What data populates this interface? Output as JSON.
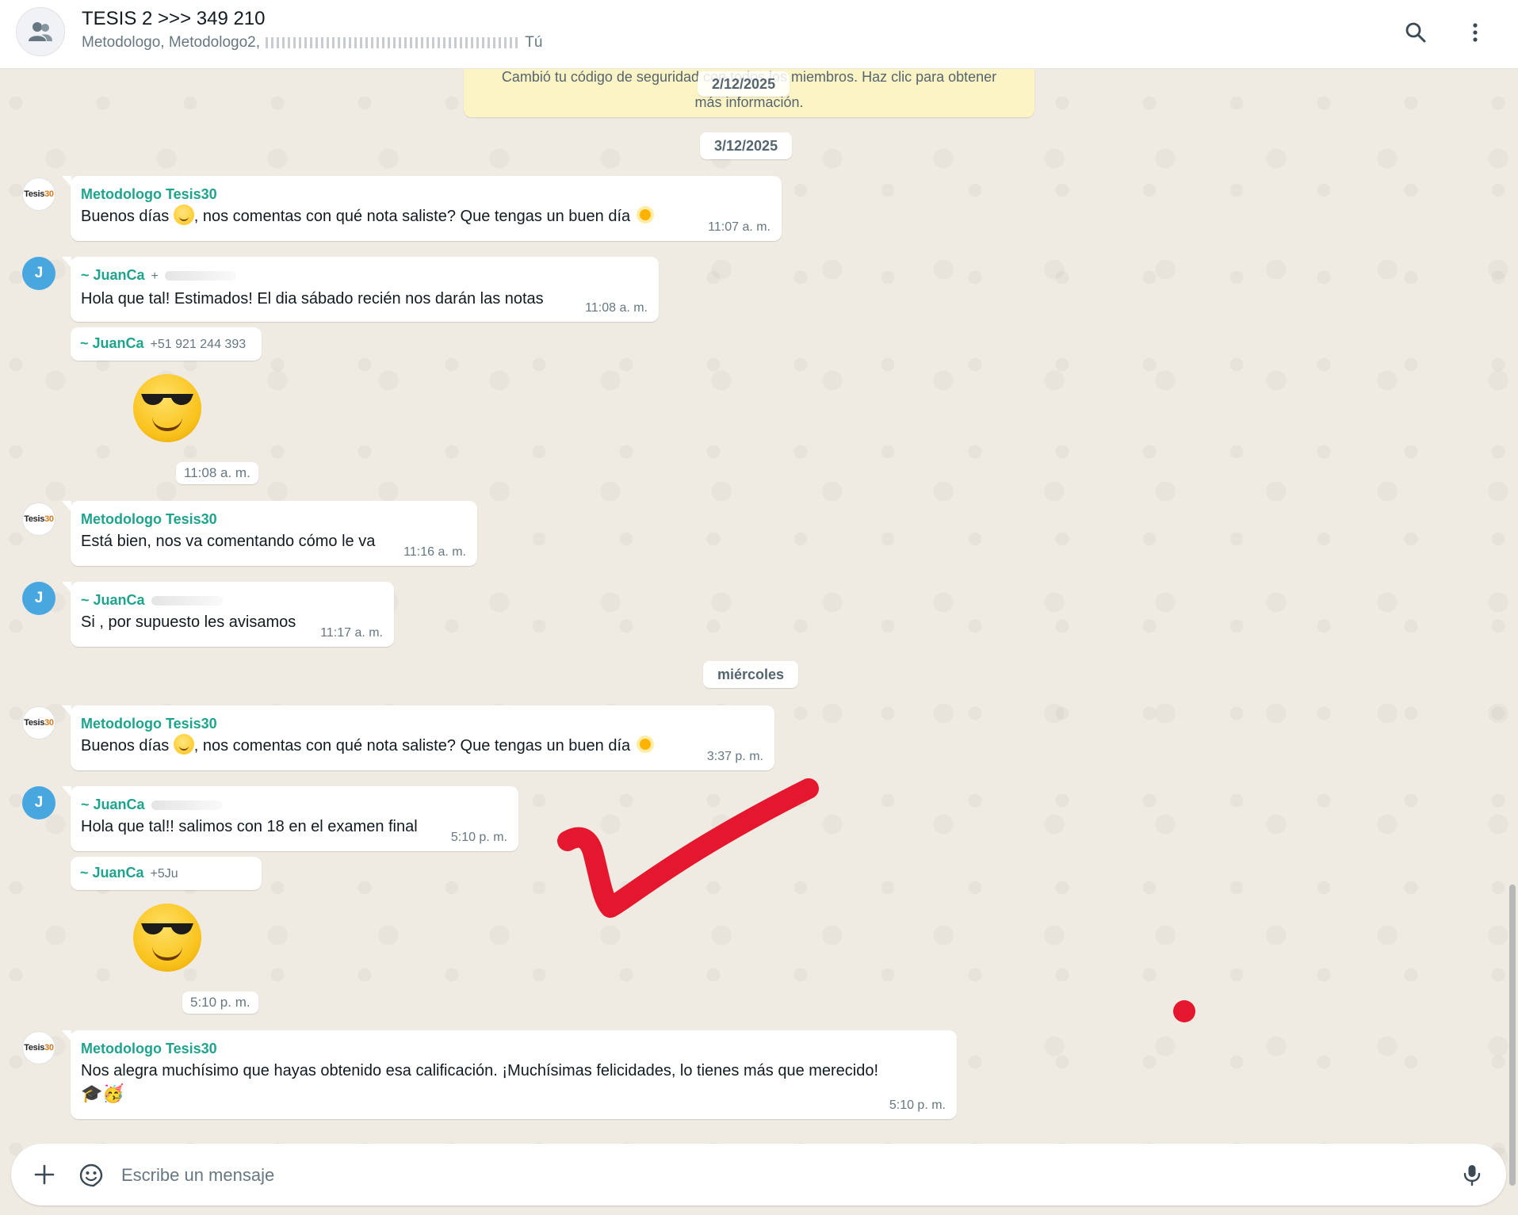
{
  "header": {
    "title": "TESIS 2 >>> 349 210",
    "subtitle_prefix": "Metodologo, Metodologo2,",
    "subtitle_suffix": "Tú"
  },
  "notice": {
    "line1": "Cambió tu código de seguridad con todos los miembros. Haz clic para obtener",
    "line2": "más información."
  },
  "dates": {
    "first": "2/12/2025",
    "second": "3/12/2025",
    "third": "miércoles"
  },
  "avatars": {
    "tesis_label_a": "Tesis",
    "tesis_label_b": "30",
    "juanca_initial": "J"
  },
  "messages": [
    {
      "sender": "Metodologo Tesis30",
      "text_a": "Buenos días ",
      "text_b": ", nos comentas con qué nota saliste? Que tengas un buen día ",
      "time": "11:07 a. m."
    },
    {
      "sender": "~ JuanCa",
      "phone": "+",
      "text": "Hola que tal! Estimados! El dia sábado recién nos darán las notas",
      "time": "11:08 a. m."
    },
    {
      "sender": "~ JuanCa",
      "phone": "+51 921 244 393",
      "time": "11:08 a. m."
    },
    {
      "sender": "Metodologo Tesis30",
      "text": "Está bien, nos va comentando cómo le va",
      "time": "11:16 a. m."
    },
    {
      "sender": "~ JuanCa",
      "text": "Si , por supuesto les avisamos",
      "time": "11:17 a. m."
    },
    {
      "sender": "Metodologo Tesis30",
      "text_a": "Buenos días ",
      "text_b": ", nos comentas con qué nota saliste? Que tengas un buen día ",
      "time": "3:37 p. m."
    },
    {
      "sender": "~ JuanCa",
      "text": "Hola que tal!! salimos con 18 en el examen final",
      "time": "5:10 p. m."
    },
    {
      "sender": "~ JuanCa",
      "phone": "+5Ju",
      "time": "5:10 p. m."
    },
    {
      "sender": "Metodologo Tesis30",
      "text": "Nos alegra muchísimo que hayas obtenido esa calificación. ¡Muchísimas felicidades, lo tienes más que merecido!",
      "emoji_line": "🎓🥳",
      "time": "5:10 p. m."
    }
  ],
  "composer": {
    "placeholder": "Escribe un mensaje"
  },
  "icons": [
    "group-icon",
    "search-icon",
    "more-vertical-icon",
    "plus-icon",
    "sticker-icon",
    "microphone-icon"
  ],
  "colors": {
    "sender_name": "#1fa38c",
    "chat_background": "#efeae2",
    "notice_background": "#fdf4c5",
    "juanca_avatar": "#49a7e0",
    "annotation_red": "#e5172f"
  }
}
